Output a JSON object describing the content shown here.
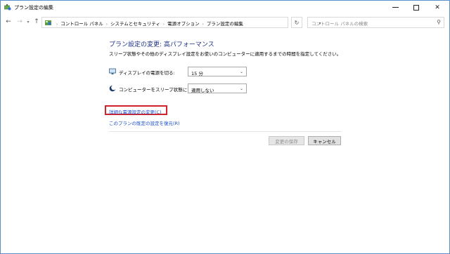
{
  "window": {
    "title": "プラン設定の編集",
    "minimize_icon": "minimize-icon",
    "maximize_icon": "maximize-icon",
    "close_icon": "close-icon"
  },
  "address": {
    "crumbs": [
      "コントロール パネル",
      "システムとセキュリティ",
      "電源オプション",
      "プラン設定の編集"
    ],
    "search_placeholder": "コントロール パネルの検索"
  },
  "content": {
    "heading": "プラン設定の変更: 高パフォーマンス",
    "description": "スリープ状態やその他のディスプレイ設定をお使いのコンピューターに適用するまでの時間を指定してください。",
    "display_off": {
      "label": "ディスプレイの電源を切る:",
      "value": "15 分"
    },
    "sleep": {
      "label": "コンピューターをスリープ状態にする:",
      "value": "適用しない"
    },
    "advanced_link": "詳細な電源設定の変更(C)",
    "restore_link": "このプランの既定の設定を復元(R)",
    "save_button": "変更の保存",
    "cancel_button": "キャンセル"
  },
  "colors": {
    "heading": "#1e3287",
    "link": "#1a4dcf",
    "highlight_box": "#d2232a"
  }
}
